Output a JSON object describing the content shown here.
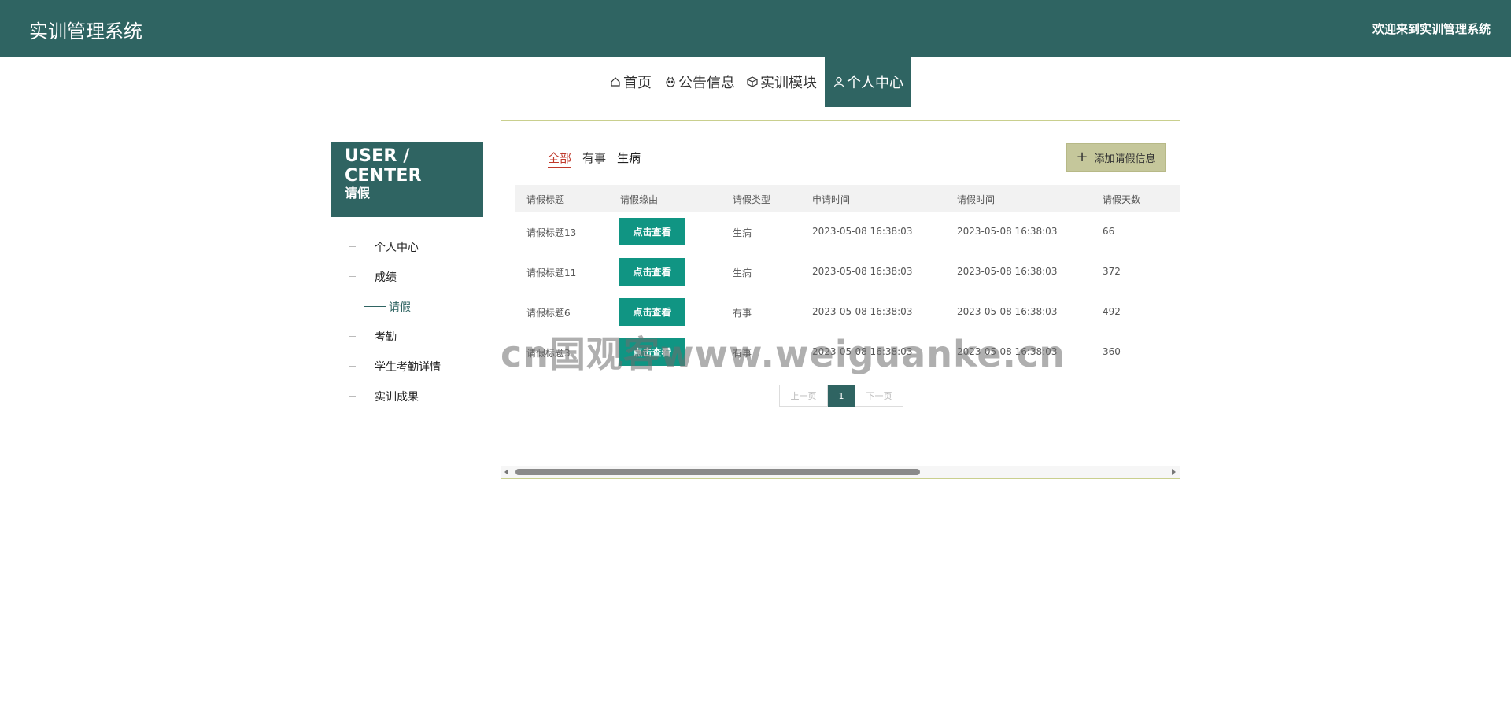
{
  "header": {
    "app_title": "实训管理系统",
    "welcome": "欢迎来到实训管理系统"
  },
  "nav": {
    "items": [
      {
        "label": "首页",
        "icon": "home-icon"
      },
      {
        "label": "公告信息",
        "icon": "notice-icon"
      },
      {
        "label": "实训模块",
        "icon": "cube-icon"
      },
      {
        "label": "个人中心",
        "icon": "user-icon",
        "active": true
      }
    ]
  },
  "sidebar": {
    "title": "USER / CENTER",
    "subtitle": "请假",
    "items": [
      {
        "label": "个人中心"
      },
      {
        "label": "成绩"
      },
      {
        "label": "请假",
        "active": true
      },
      {
        "label": "考勤"
      },
      {
        "label": "学生考勤详情"
      },
      {
        "label": "实训成果"
      }
    ]
  },
  "main": {
    "tabs": [
      {
        "label": "全部",
        "active": true
      },
      {
        "label": "有事"
      },
      {
        "label": "生病"
      }
    ],
    "add_button": "添加请假信息",
    "table": {
      "headers": [
        "请假标题",
        "请假缘由",
        "请假类型",
        "申请时间",
        "请假时间",
        "请假天数"
      ],
      "view_label": "点击查看",
      "rows": [
        {
          "title": "请假标题13",
          "type": "生病",
          "apply_time": "2023-05-08 16:38:03",
          "leave_time": "2023-05-08 16:38:03",
          "days": "66"
        },
        {
          "title": "请假标题11",
          "type": "生病",
          "apply_time": "2023-05-08 16:38:03",
          "leave_time": "2023-05-08 16:38:03",
          "days": "372"
        },
        {
          "title": "请假标题6",
          "type": "有事",
          "apply_time": "2023-05-08 16:38:03",
          "leave_time": "2023-05-08 16:38:03",
          "days": "492"
        },
        {
          "title": "请假标题3",
          "type": "有事",
          "apply_time": "2023-05-08 16:38:03",
          "leave_time": "2023-05-08 16:38:03",
          "days": "360"
        }
      ]
    },
    "pager": {
      "prev": "上一页",
      "current": "1",
      "next": "下一页"
    }
  },
  "watermark": "cn国观客www.weiguanke.cn",
  "colors": {
    "primary": "#2f6462",
    "view_button": "#109583",
    "add_button": "#c5c79b",
    "tab_active": "#c0392b",
    "content_border": "#c9cf8e"
  }
}
